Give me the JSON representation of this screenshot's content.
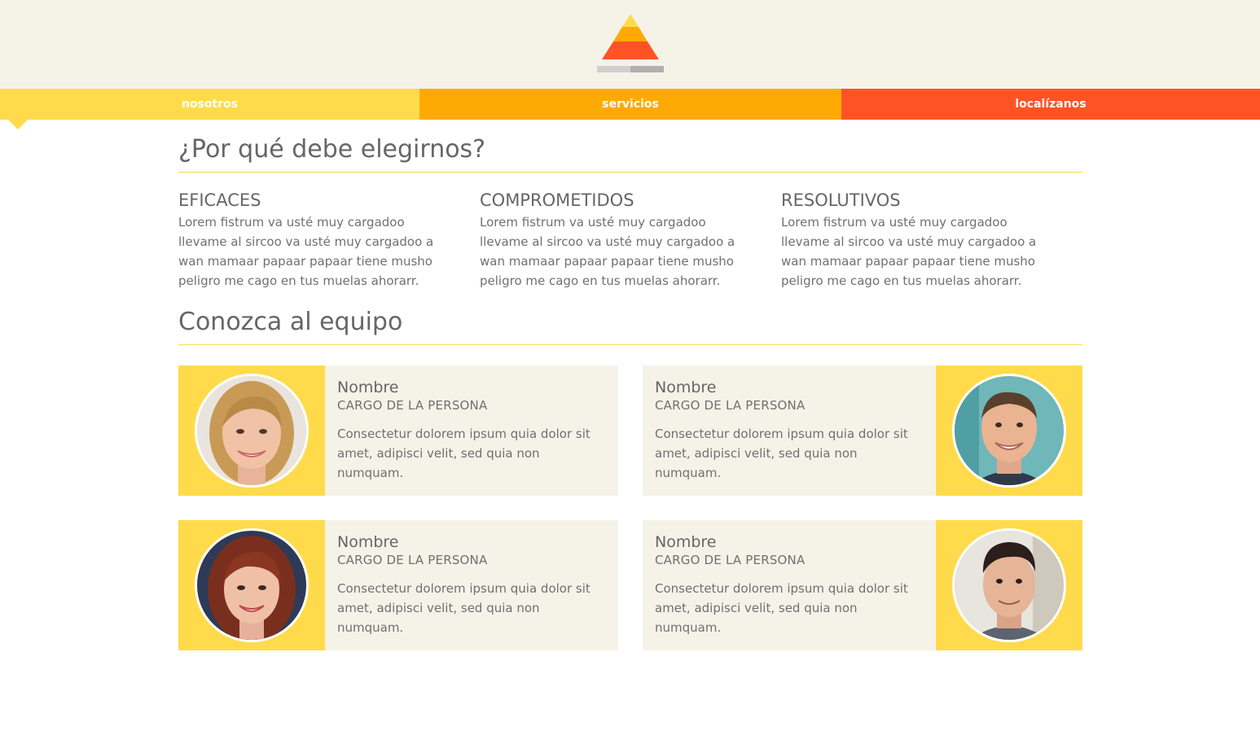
{
  "colors": {
    "yellow": "#ffdb4b",
    "orange": "#ffaa04",
    "red": "#ff5326",
    "cream": "#f5f3e8",
    "text": "#666666"
  },
  "logo": {
    "icon": "pyramid-logo-icon"
  },
  "nav": {
    "items": [
      {
        "label": "nosotros"
      },
      {
        "label": "servicios"
      },
      {
        "label": "localízanos"
      }
    ]
  },
  "why": {
    "title": "¿Por qué debe elegirnos?",
    "features": [
      {
        "title": "EFICACES",
        "text": "Lorem fistrum va usté muy cargadoo llevame al sircoo va usté muy cargadoo a wan mamaar papaar papaar tiene musho peligro me cago en tus muelas ahorarr."
      },
      {
        "title": "COMPROMETIDOS",
        "text": "Lorem fistrum va usté muy cargadoo llevame al sircoo va usté muy cargadoo a wan mamaar papaar papaar tiene musho peligro me cago en tus muelas ahorarr."
      },
      {
        "title": "RESOLUTIVOS",
        "text": "Lorem fistrum va usté muy cargadoo llevame al sircoo va usté muy cargadoo a wan mamaar papaar papaar tiene musho peligro me cago en tus muelas ahorarr."
      }
    ]
  },
  "team": {
    "title": "Conozca al equipo",
    "members": [
      {
        "name": "Nombre",
        "role": "CARGO DE LA PERSONA",
        "desc": "Consectetur dolorem ipsum quia dolor sit amet, adipisci velit, sed quia non numquam."
      },
      {
        "name": "Nombre",
        "role": "CARGO DE LA PERSONA",
        "desc": "Consectetur dolorem ipsum quia dolor sit amet, adipisci velit, sed quia non numquam."
      },
      {
        "name": "Nombre",
        "role": "CARGO DE LA PERSONA",
        "desc": "Consectetur dolorem ipsum quia dolor sit amet, adipisci velit, sed quia non numquam."
      },
      {
        "name": "Nombre",
        "role": "CARGO DE LA PERSONA",
        "desc": "Consectetur dolorem ipsum quia dolor sit amet, adipisci velit, sed quia non numquam."
      }
    ]
  }
}
